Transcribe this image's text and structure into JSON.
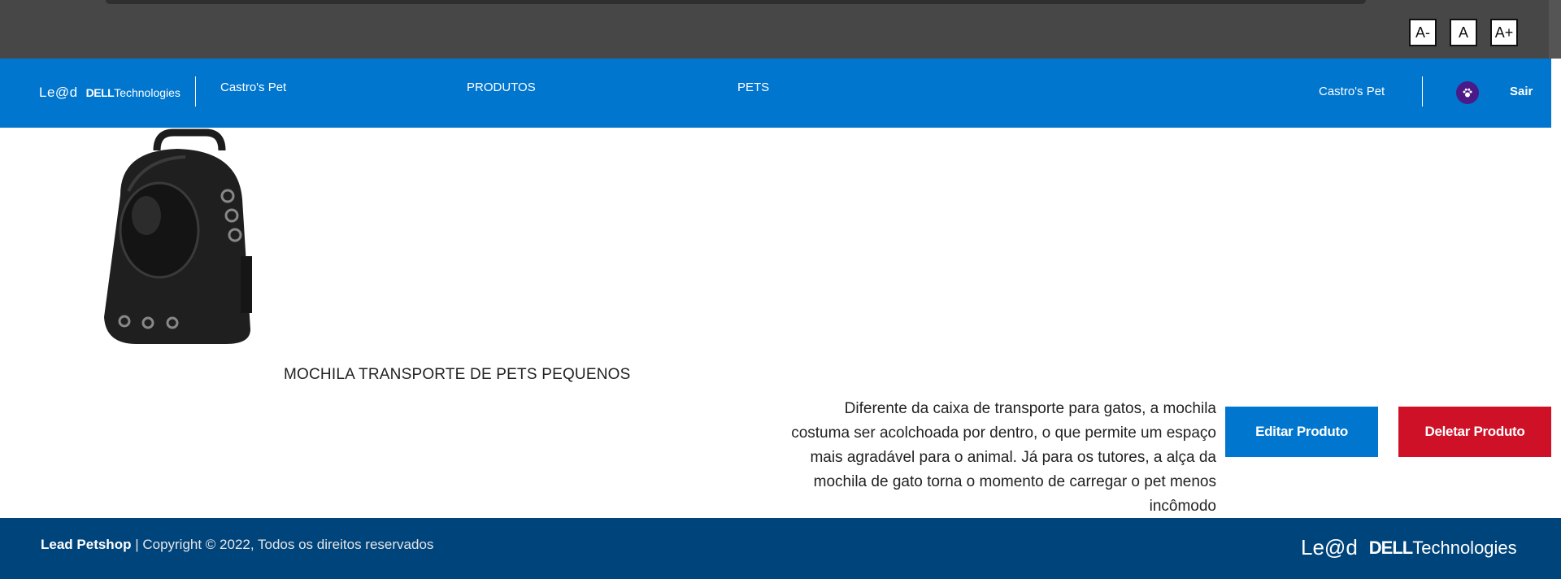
{
  "accessibility": {
    "decrease_label": "A-",
    "reset_label": "A",
    "increase_label": "A+"
  },
  "header": {
    "logo_lead": "Le@d",
    "logo_dell": "DELL",
    "logo_tech": "Technologies",
    "nav": {
      "home": "Castro's Pet",
      "products": "PRODUTOS",
      "pets": "PETS"
    },
    "user_name": "Castro's Pet",
    "avatar_icon": "paw-icon",
    "logout": "Sair"
  },
  "product": {
    "image_icon": "pet-backpack-image",
    "title": "MOCHILA TRANSPORTE DE PETS PEQUENOS",
    "description": "Diferente da caixa de transporte para gatos, a mochila costuma ser acolchoada por dentro, o que permite um espaço mais agradável para o animal. Já para os tutores, a alça da mochila de gato torna o momento de carregar o pet menos incômodo",
    "edit_label": "Editar Produto",
    "delete_label": "Deletar Produto"
  },
  "footer": {
    "brand": "Lead Petshop",
    "copyright": " | Copyright © 2022, Todos os direitos reservados",
    "logo_lead": "Le@d",
    "logo_dell": "DELL",
    "logo_tech": "Technologies"
  },
  "colors": {
    "nav_bg": "#0076ce",
    "footer_bg": "#00447c",
    "delete_bg": "#ce1126",
    "topbar_bg": "#474747"
  }
}
